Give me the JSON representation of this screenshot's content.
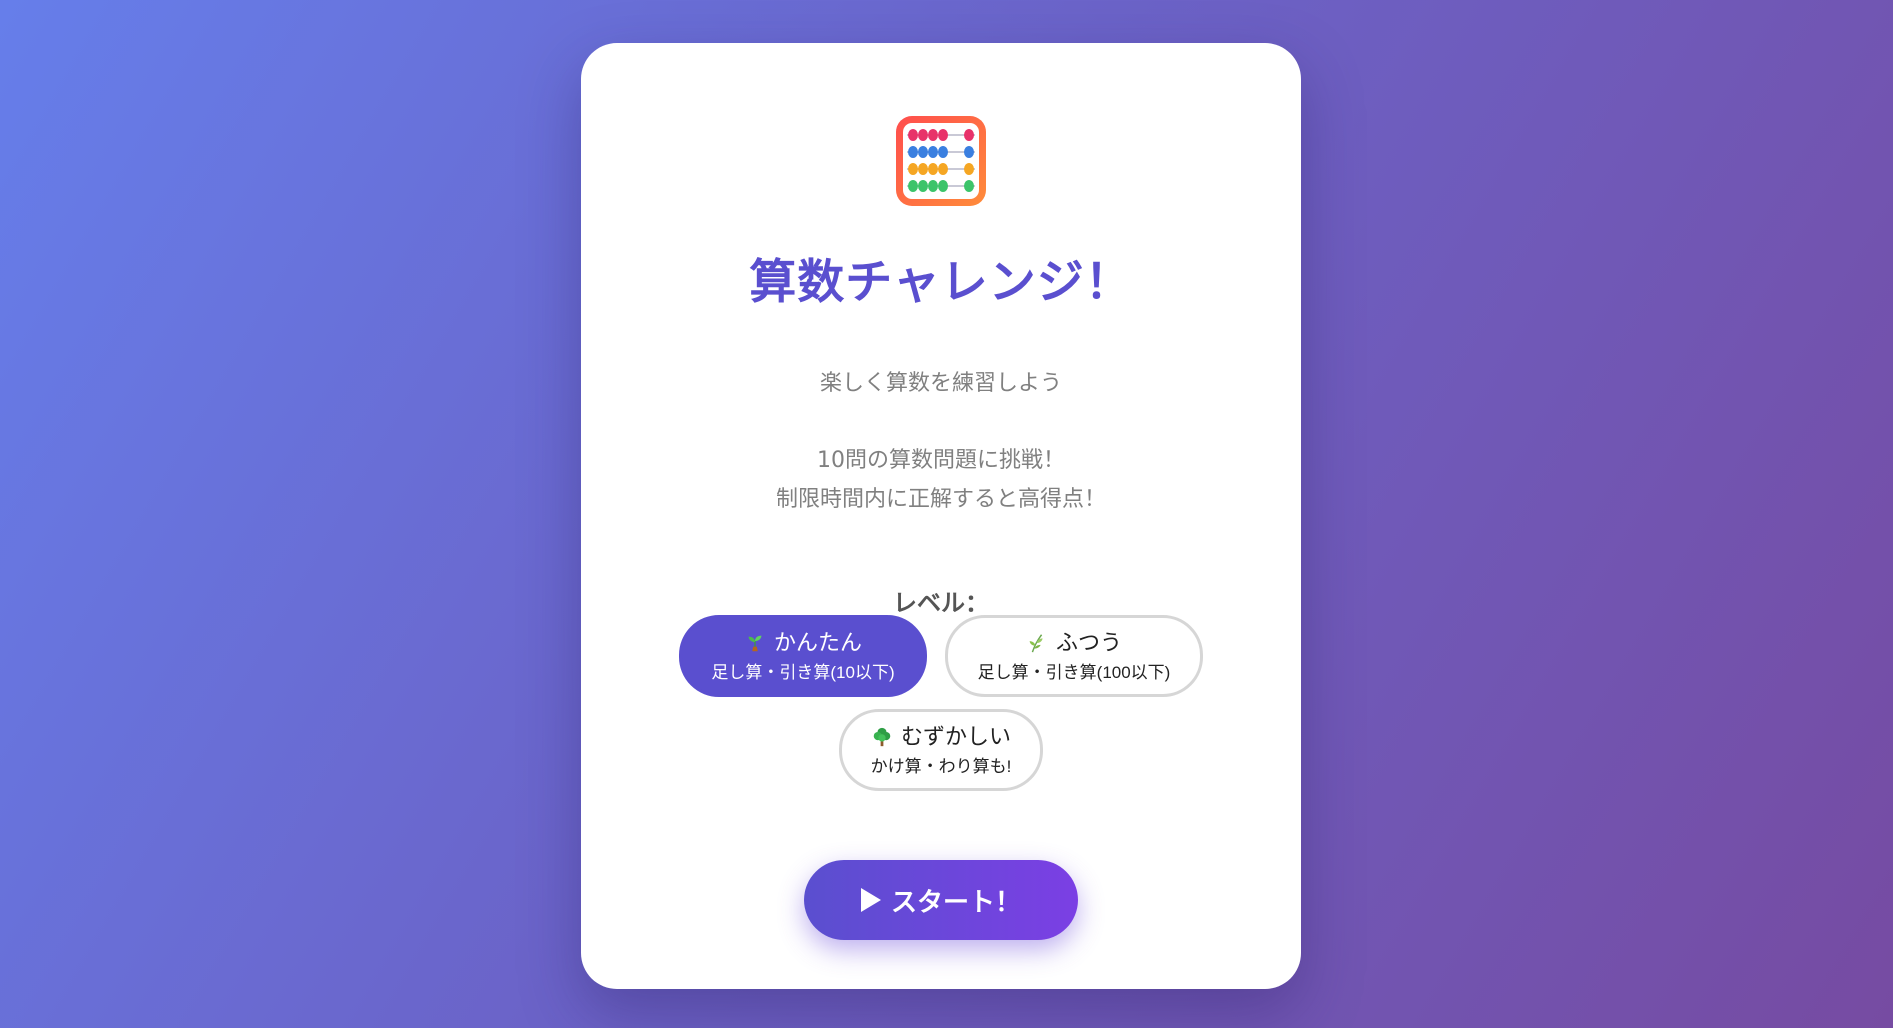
{
  "app": {
    "logo_icon": "abacus-icon",
    "title": "算数チャレンジ！",
    "subtitle": "楽しく算数を練習しよう",
    "description": [
      "10問の算数問題に挑戦！",
      "制限時間内に正解すると高得点！"
    ]
  },
  "levels": {
    "label": "レベル：",
    "selected": "easy",
    "items": [
      {
        "id": "easy",
        "icon": "sprout-icon",
        "name": "かんたん",
        "detail": "足し算・引き算(10以下)"
      },
      {
        "id": "normal",
        "icon": "herb-icon",
        "name": "ふつう",
        "detail": "足し算・引き算(100以下)"
      },
      {
        "id": "hard",
        "icon": "tree-icon",
        "name": "むずかしい",
        "detail": "かけ算・わり算も!"
      }
    ]
  },
  "start": {
    "icon": "play-icon",
    "label": "スタート！"
  },
  "colors": {
    "accent": "#5a4fcf",
    "accent_end": "#7b3fe4",
    "background_start": "#667eea",
    "background_end": "#764ba2",
    "muted_text": "#808080"
  }
}
